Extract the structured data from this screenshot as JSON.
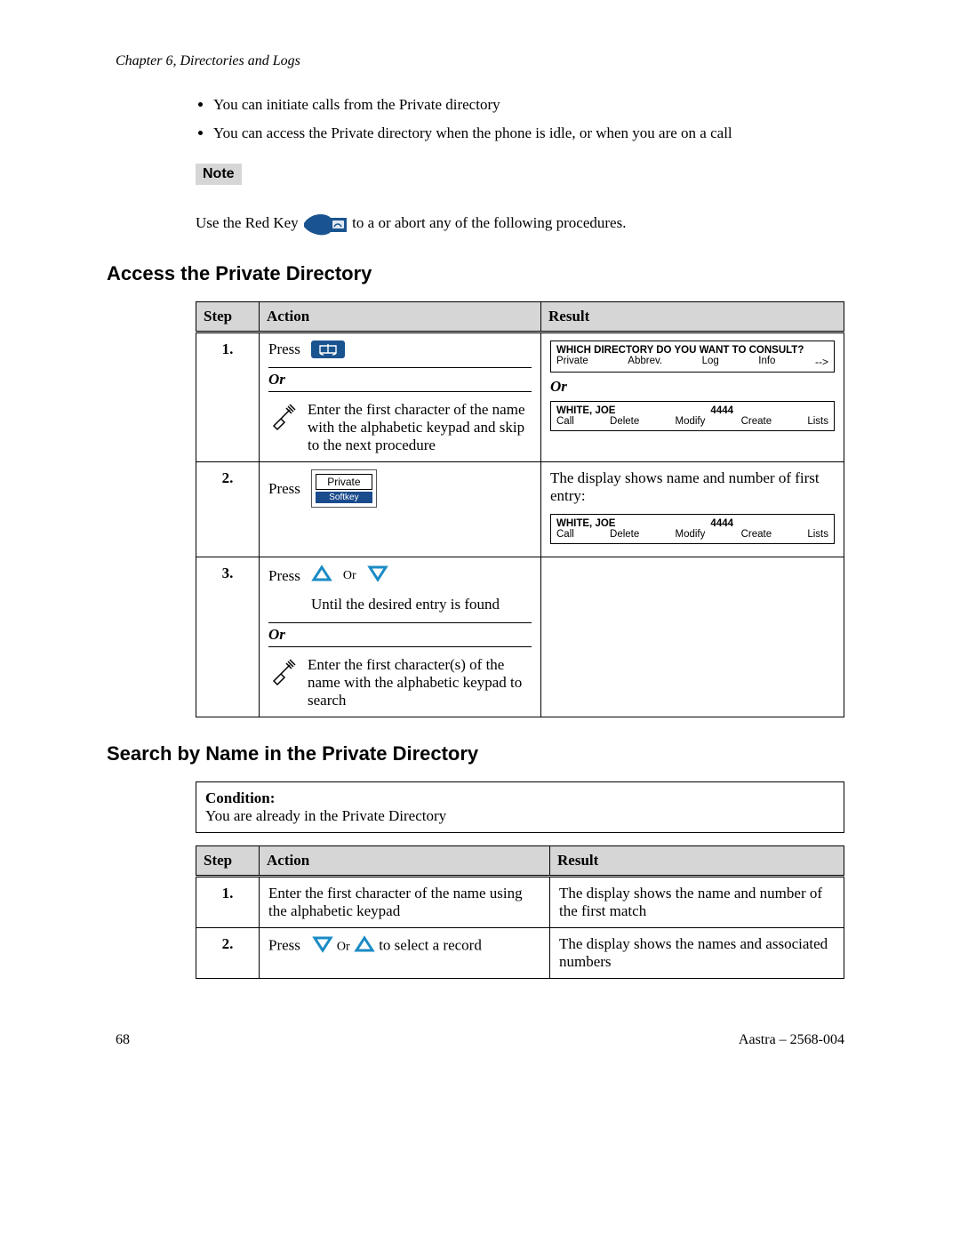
{
  "header": {
    "chapter": "Chapter 6, Directories and Logs"
  },
  "bullets": [
    "You can initiate calls from the Private directory",
    "You can access the Private directory when the phone is idle, or when you are on a call"
  ],
  "note": {
    "label": "Note",
    "text_before": "Use the Red Key ",
    "text_after": " to a or abort any of the following procedures."
  },
  "section1": {
    "title": "Access the Private Directory",
    "headers": {
      "step": "Step",
      "action": "Action",
      "result": "Result"
    },
    "steps": [
      {
        "num": "1.",
        "press": "Press",
        "or": "Or",
        "alt": "Enter the first character of the name with the alphabetic keypad and skip to the next procedure",
        "display1": {
          "title": "WHICH DIRECTORY DO YOU WANT TO CONSULT?",
          "opts": [
            "Private",
            "Abbrev.",
            "Log",
            "Info",
            "-->"
          ]
        },
        "or_result": "Or",
        "display2": {
          "name": "WHITE, JOE",
          "num": "4444",
          "opts": [
            "Call",
            "Delete",
            "Modify",
            "Create",
            "Lists"
          ]
        }
      },
      {
        "num": "2.",
        "press": "Press",
        "softkey_top": "Private",
        "softkey_bot": "Softkey",
        "result_text": "The display shows name and number of first entry:",
        "display": {
          "name": "WHITE, JOE",
          "num": "4444",
          "opts": [
            "Call",
            "Delete",
            "Modify",
            "Create",
            "Lists"
          ]
        }
      },
      {
        "num": "3.",
        "press": "Press",
        "or_inline": "Or",
        "until": "Until the desired entry is found",
        "or": "Or",
        "alt": "Enter the first character(s) of the name with the alphabetic keypad to search"
      }
    ]
  },
  "section2": {
    "title": "Search by Name in the Private Directory",
    "condition_label": "Condition:",
    "condition_text": "You are already in the Private Directory",
    "headers": {
      "step": "Step",
      "action": "Action",
      "result": "Result"
    },
    "steps": [
      {
        "num": "1.",
        "action": "Enter the first character of the name using the alphabetic keypad",
        "result": "The display shows the name and number of the first match"
      },
      {
        "num": "2.",
        "press": "Press",
        "or_inline": "Or",
        "tail": " to select a record",
        "result": "The display shows the names and associated numbers"
      }
    ]
  },
  "footer": {
    "page": "68",
    "book": "Aastra – 2568-004"
  }
}
